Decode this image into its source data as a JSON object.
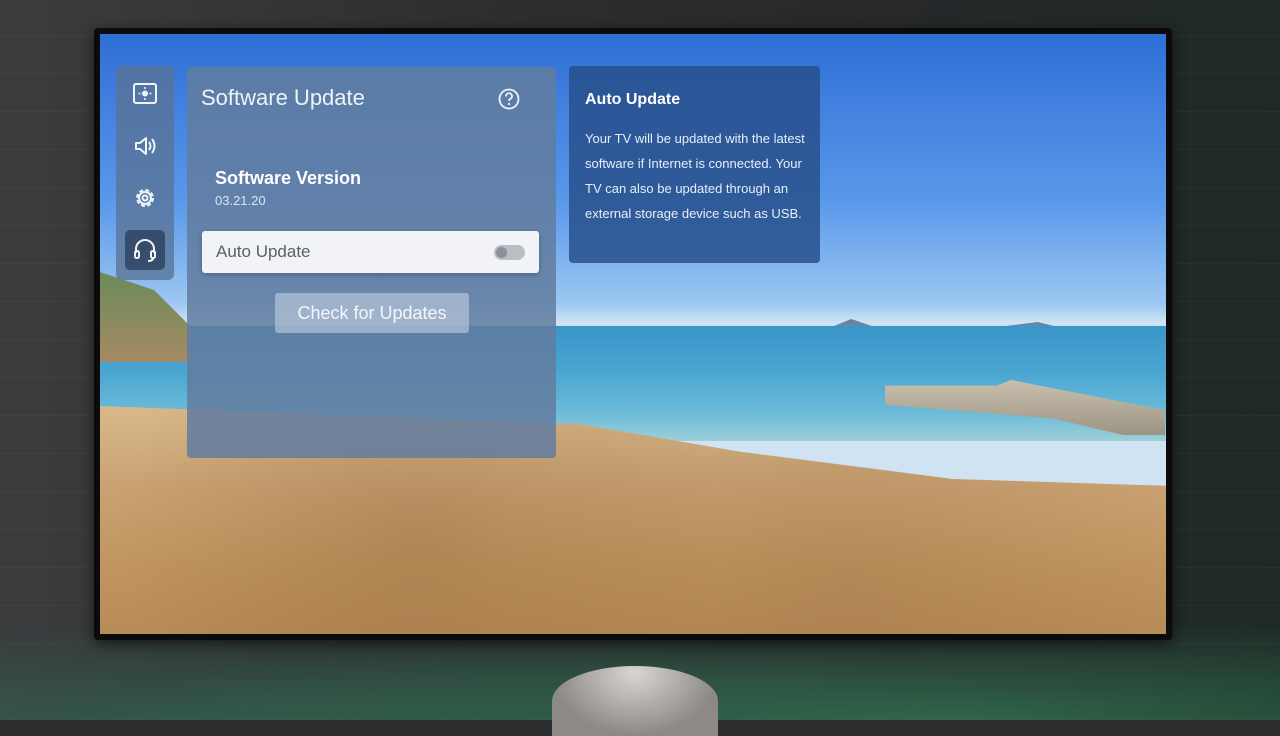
{
  "rail": {
    "items": [
      {
        "icon": "picture-icon",
        "active": false
      },
      {
        "icon": "speaker-icon",
        "active": false
      },
      {
        "icon": "gear-icon",
        "active": false
      },
      {
        "icon": "headset-icon",
        "active": true
      }
    ]
  },
  "panel": {
    "title": "Software Update",
    "software_version_label": "Software Version",
    "software_version_value": "03.21.20",
    "auto_update_label": "Auto Update",
    "auto_update_on": false,
    "check_button_label": "Check for Updates"
  },
  "info": {
    "title": "Auto Update",
    "text": "Your TV will be updated with the latest software if Internet is connected. Your TV can also be updated through an external storage device such as USB."
  }
}
